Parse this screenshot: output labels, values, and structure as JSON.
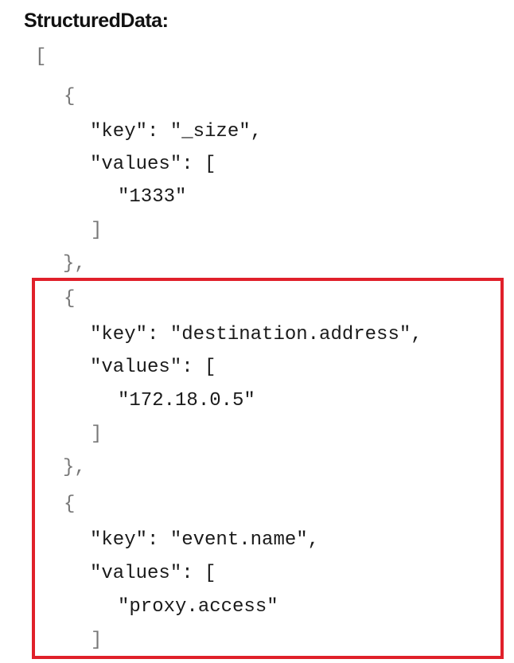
{
  "heading": "StructuredData:",
  "structured_data": [
    {
      "key": "_size",
      "values": [
        "1333"
      ]
    },
    {
      "key": "destination.address",
      "values": [
        "172.18.0.5"
      ]
    },
    {
      "key": "event.name",
      "values": [
        "proxy.access"
      ]
    }
  ],
  "code_tokens": {
    "open_array": "[",
    "open_obj": "{",
    "close_obj_comma": "},",
    "close_array": "]",
    "key_line_1": "\"key\": \"_size\",",
    "values_line": "\"values\": [",
    "value_1": "\"1333\"",
    "key_line_2": "\"key\": \"destination.address\",",
    "value_2": "\"172.18.0.5\"",
    "key_line_3": "\"key\": \"event.name\",",
    "value_3": "\"proxy.access\""
  },
  "colors": {
    "highlight_border": "#e0202a",
    "text": "#1a1a1a",
    "bracket": "#777777"
  }
}
